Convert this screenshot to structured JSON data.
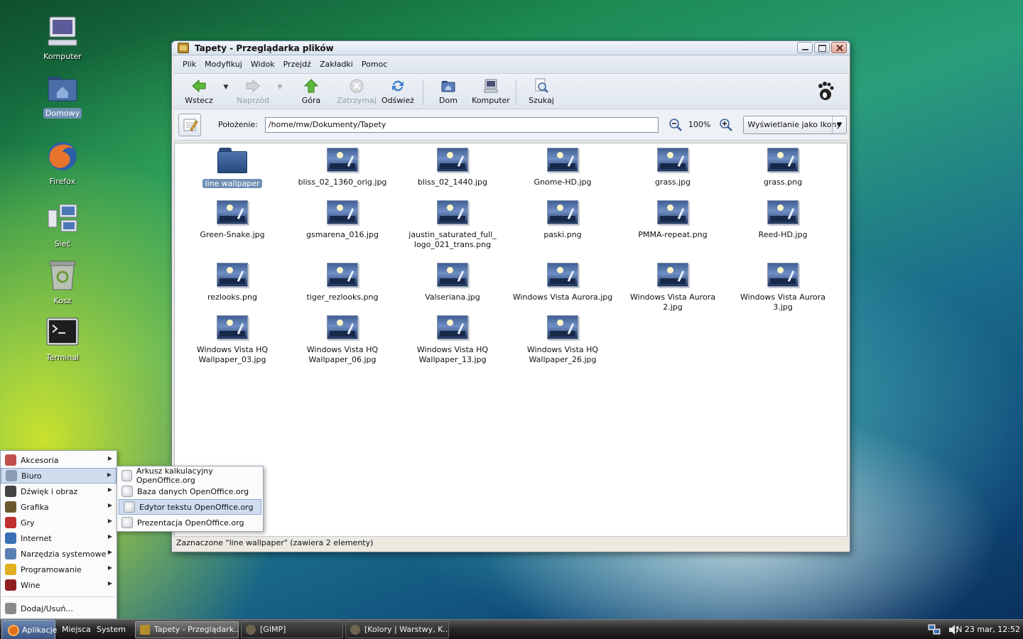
{
  "desktop": {
    "icons": [
      {
        "label": "Komputer"
      },
      {
        "label": "Domowy"
      },
      {
        "label": "Firefox"
      },
      {
        "label": "Sieć"
      },
      {
        "label": "Kosz"
      },
      {
        "label": "Terminal"
      }
    ]
  },
  "window": {
    "title": "Tapety - Przeglądarka plików",
    "menu": [
      "Plik",
      "Modyfikuj",
      "Widok",
      "Przejdź",
      "Zakładki",
      "Pomoc"
    ],
    "toolbar": {
      "back": "Wstecz",
      "forward": "Naprzód",
      "up": "Góra",
      "stop": "Zatrzymaj",
      "reload": "Odśwież",
      "home": "Dom",
      "computer": "Komputer",
      "search": "Szukaj"
    },
    "location": {
      "label": "Położenie:",
      "path": "/home/mw/Dokumenty/Tapety",
      "zoom": "100%",
      "view_mode": "Wyświetlanie jako Ikony"
    },
    "files": [
      {
        "name": "line wallpaper",
        "type": "folder",
        "selected": true
      },
      {
        "name": "bliss_02_1360_orig.jpg",
        "type": "image"
      },
      {
        "name": "bliss_02_1440.jpg",
        "type": "image"
      },
      {
        "name": "Gnome-HD.jpg",
        "type": "image"
      },
      {
        "name": "grass.jpg",
        "type": "image"
      },
      {
        "name": "grass.png",
        "type": "image"
      },
      {
        "name": "Green-Snake.jpg",
        "type": "image"
      },
      {
        "name": "gsmarena_016.jpg",
        "type": "image"
      },
      {
        "name": "jaustin_saturated_full_\nlogo_021_trans.png",
        "type": "image"
      },
      {
        "name": "paski.png",
        "type": "image"
      },
      {
        "name": "PMMA-repeat.png",
        "type": "image"
      },
      {
        "name": "Reed-HD.jpg",
        "type": "image"
      },
      {
        "name": "rezlooks.png",
        "type": "image"
      },
      {
        "name": "tiger_rezlooks.png",
        "type": "image"
      },
      {
        "name": "Valseriana.jpg",
        "type": "image"
      },
      {
        "name": "Windows Vista Aurora.jpg",
        "type": "image"
      },
      {
        "name": "Windows Vista Aurora 2.jpg",
        "type": "image"
      },
      {
        "name": "Windows Vista Aurora 3.jpg",
        "type": "image"
      },
      {
        "name": "Windows Vista HQ\nWallpaper_03.jpg",
        "type": "image"
      },
      {
        "name": "Windows Vista HQ\nWallpaper_06.jpg",
        "type": "image"
      },
      {
        "name": "Windows Vista HQ\nWallpaper_13.jpg",
        "type": "image"
      },
      {
        "name": "Windows Vista HQ\nWallpaper_26.jpg",
        "type": "image"
      }
    ],
    "status": "Zaznaczone \"line wallpaper\" (zawiera 2 elementy)"
  },
  "apps_menu": {
    "items": [
      {
        "label": "Akcesoria",
        "icon": "accessories-icon",
        "color": "#c0504d"
      },
      {
        "label": "Biuro",
        "icon": "office-icon",
        "color": "#8a9bb5",
        "active": true
      },
      {
        "label": "Dźwięk i obraz",
        "icon": "multimedia-icon",
        "color": "#444444"
      },
      {
        "label": "Grafika",
        "icon": "graphics-icon",
        "color": "#6b5a2e"
      },
      {
        "label": "Gry",
        "icon": "games-icon",
        "color": "#c03030"
      },
      {
        "label": "Internet",
        "icon": "internet-icon",
        "color": "#3a6fb5"
      },
      {
        "label": "Narzędzia systemowe",
        "icon": "system-tools-icon",
        "color": "#5a7fb5"
      },
      {
        "label": "Programowanie",
        "icon": "programming-icon",
        "color": "#e0b020"
      },
      {
        "label": "Wine",
        "icon": "wine-icon",
        "color": "#902020"
      }
    ],
    "add_remove": "Dodaj/Usuń...",
    "submenu": [
      {
        "label": "Arkusz kalkulacyjny OpenOffice.org"
      },
      {
        "label": "Baza danych OpenOffice.org"
      },
      {
        "label": "Edytor tekstu OpenOffice.org",
        "active": true
      },
      {
        "label": "Prezentacja OpenOffice.org"
      }
    ]
  },
  "panel": {
    "applications": "Aplikacje",
    "places": "Miejsca",
    "system": "System",
    "tasks": [
      {
        "label": "Tapety - Przeglądark..."
      },
      {
        "label": "[GIMP]"
      },
      {
        "label": "[Kolory | Warstwy, K..."
      }
    ],
    "clock": "N 23 mar, 12:52"
  }
}
